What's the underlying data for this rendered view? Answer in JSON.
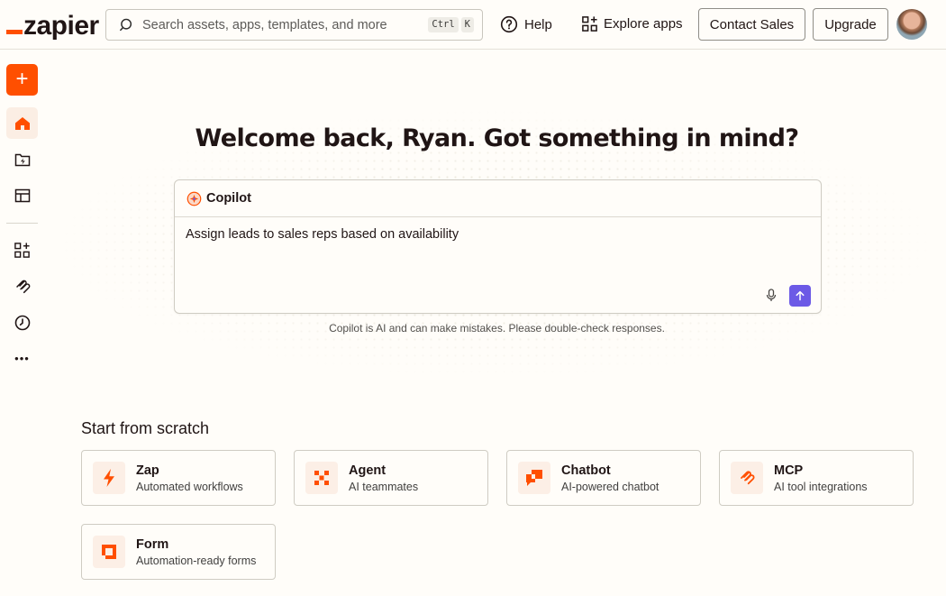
{
  "brand": {
    "name": "zapier",
    "accent": "#ff4f00",
    "purple": "#6c5ae6"
  },
  "header": {
    "search_placeholder": "Search assets, apps, templates, and more",
    "shortcut_keys": [
      "Ctrl",
      "K"
    ],
    "help_label": "Help",
    "explore_label": "Explore apps",
    "contact_label": "Contact Sales",
    "upgrade_label": "Upgrade"
  },
  "sidebar": {
    "create_label": "+",
    "items": [
      {
        "icon": "home-icon"
      },
      {
        "icon": "zap-folder-icon"
      },
      {
        "icon": "tables-icon"
      },
      {
        "icon": "apps-grid-icon"
      },
      {
        "icon": "mcp-icon"
      },
      {
        "icon": "history-clock-icon"
      },
      {
        "icon": "more-dots-icon"
      }
    ],
    "more_label": "•••"
  },
  "main": {
    "welcome": "Welcome back, Ryan. Got something in mind?",
    "copilot": {
      "title": "Copilot",
      "prompt_text": "Assign leads to sales reps based on availability"
    },
    "disclaimer": "Copilot is AI and can make mistakes. Please double-check responses.",
    "scratch": {
      "title": "Start from scratch",
      "cards": [
        {
          "title": "Zap",
          "subtitle": "Automated workflows",
          "icon": "zap-bolt-icon"
        },
        {
          "title": "Agent",
          "subtitle": "AI teammates",
          "icon": "agent-icon"
        },
        {
          "title": "Chatbot",
          "subtitle": "AI-powered chatbot",
          "icon": "chatbot-icon"
        },
        {
          "title": "MCP",
          "subtitle": "AI tool integrations",
          "icon": "mcp-icon"
        },
        {
          "title": "Form",
          "subtitle": "Automation-ready forms",
          "icon": "form-icon"
        }
      ]
    }
  }
}
